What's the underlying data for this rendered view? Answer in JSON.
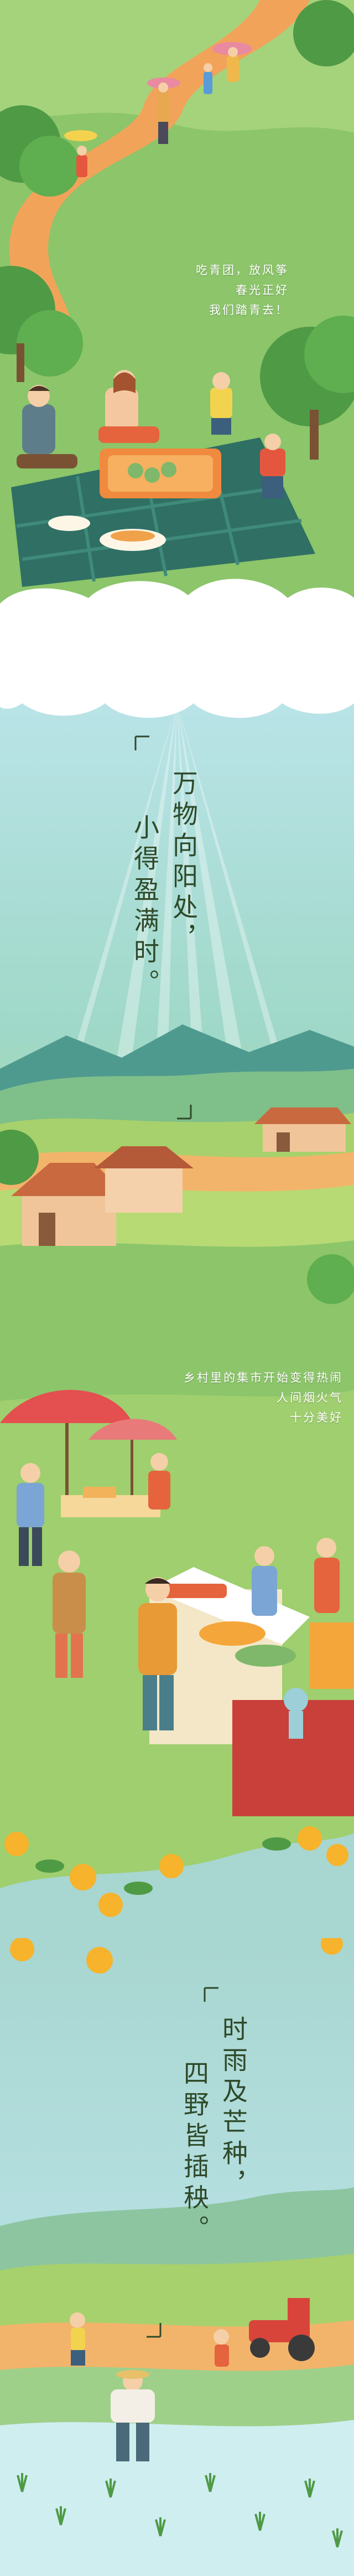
{
  "picnic": {
    "caption_lines": [
      "吃青团，放风筝",
      "春光正好",
      "我们踏青去！"
    ]
  },
  "spring": {
    "verse_col1": "万物向阳处，",
    "verse_col2": "小得盈满时。"
  },
  "market": {
    "caption_lines": [
      "乡村里的集市开始变得热闹",
      "人间烟火气",
      "十分美好"
    ]
  },
  "fields": {
    "verse_col1": "时雨及芒种，",
    "verse_col2": "四野皆插秧。"
  },
  "colors": {
    "grass": "#8cc56a",
    "path": "#f2a35a",
    "sky_top": "#bfe6ee",
    "text_dark": "#2f4a2a"
  }
}
